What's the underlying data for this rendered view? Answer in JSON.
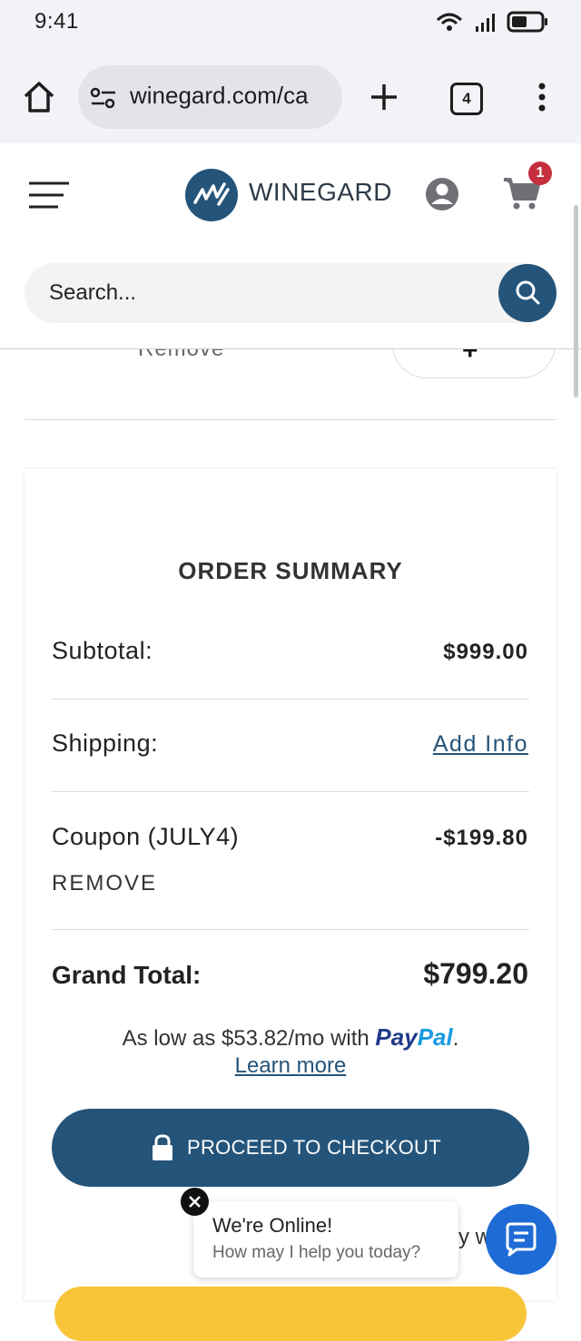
{
  "status_bar": {
    "time": "9:41"
  },
  "browser": {
    "url": "winegard.com/ca",
    "tab_count": "4"
  },
  "site": {
    "brand": "WINEGARD",
    "cart_count": "1",
    "search_placeholder": "Search..."
  },
  "cart_row": {
    "remove_label": "Remove",
    "plus_label": "+"
  },
  "order_summary": {
    "title": "ORDER SUMMARY",
    "subtotal_label": "Subtotal:",
    "subtotal_value": "$999.00",
    "shipping_label": "Shipping:",
    "shipping_action": "Add Info",
    "coupon_label": "Coupon (JULY4)",
    "coupon_value": "-$199.80",
    "coupon_remove": "REMOVE",
    "grand_total_label": "Grand Total:",
    "grand_total_value": "$799.20",
    "paypal_text": "As low as $53.82/mo with",
    "paypal_pay": "Pay",
    "paypal_pal": "Pal",
    "paypal_period": ".",
    "learn_more": "Learn more",
    "checkout_label": "PROCEED TO CHECKOUT"
  },
  "chat": {
    "title": "We're Online!",
    "subtitle": "How may I help you today?",
    "behind_text": "y w"
  },
  "colors": {
    "brand_blue": "#24547a",
    "badge_red": "#c6303e",
    "chat_blue": "#1e6bd6",
    "paypal_yellow": "#f8c539",
    "paypal_dark": "#1f3a8a",
    "paypal_light": "#1a9be0"
  }
}
